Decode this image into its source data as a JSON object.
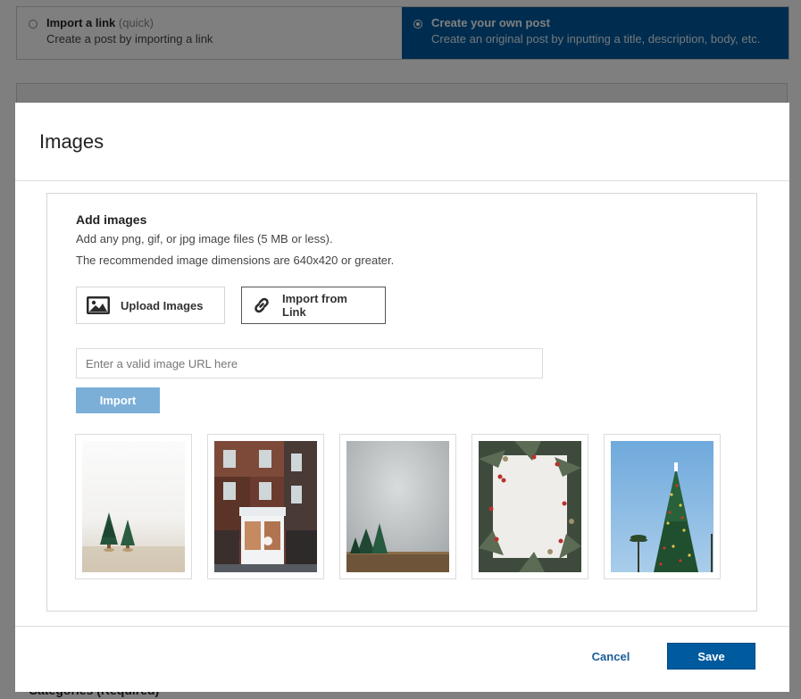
{
  "post_type": {
    "import_link": {
      "title": "Import a link",
      "title_note": "(quick)",
      "description": "Create a post by importing a link"
    },
    "create_own": {
      "title": "Create your own post",
      "description": "Create an original post by inputting a title, description, body, etc."
    }
  },
  "background": {
    "bottom_label": "Categories (Required)"
  },
  "modal": {
    "title": "Images",
    "heading": "Add images",
    "line1": "Add any png, gif, or jpg image files (5 MB or less).",
    "line2": "The recommended image dimensions are 640x420 or greater.",
    "tabs": {
      "upload_label": "Upload Images",
      "import_label": "Import from Link"
    },
    "url_placeholder": "Enter a valid image URL here",
    "import_button": "Import",
    "thumbnails": [
      "trees-on-white",
      "storefront-snow",
      "trees-concrete-wall",
      "wreath-frame",
      "christmas-tree-sky"
    ],
    "cancel_label": "Cancel",
    "save_label": "Save"
  },
  "colors": {
    "brand_blue": "#005a9e",
    "import_button_blue": "#7bafd8",
    "link_blue": "#1a5e9a"
  }
}
